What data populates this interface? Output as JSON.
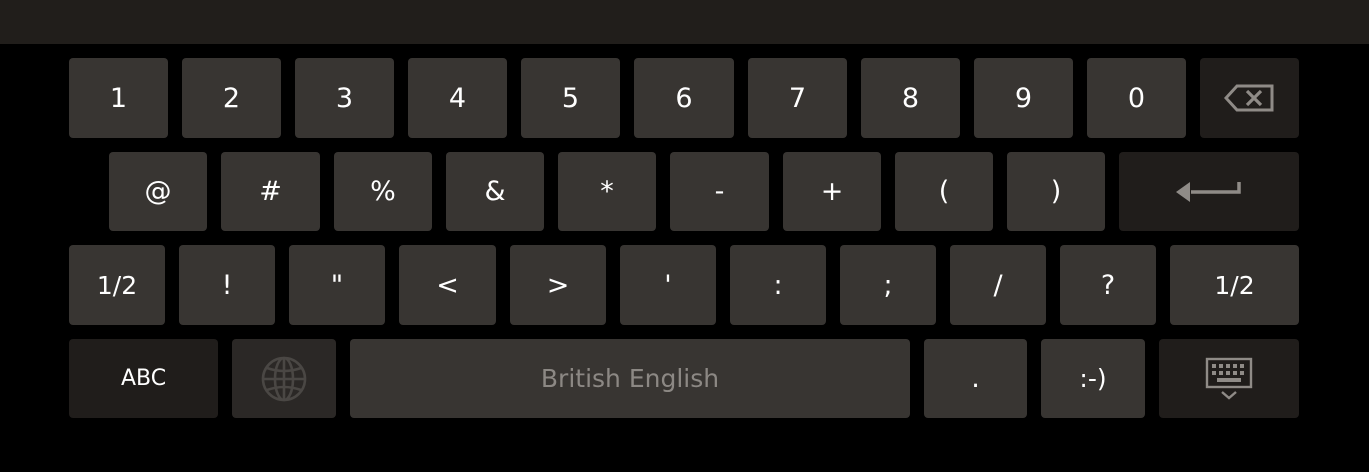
{
  "keyboard": {
    "row1": [
      "1",
      "2",
      "3",
      "4",
      "5",
      "6",
      "7",
      "8",
      "9",
      "0"
    ],
    "row2": [
      "@",
      "#",
      "%",
      "&",
      "*",
      "-",
      "+",
      "(",
      ")"
    ],
    "row3": [
      "1/2",
      "!",
      "\"",
      "<",
      ">",
      "'",
      ":",
      ";",
      "/",
      "?",
      "1/2"
    ],
    "row4": {
      "abc_label": "ABC",
      "space_label": "British English",
      "period_label": ".",
      "smiley_label": ":-)"
    },
    "icons": {
      "backspace": "backspace-icon",
      "enter": "enter-arrow-icon",
      "language": "globe-icon",
      "hide_keyboard": "keyboard-hide-icon"
    },
    "colors": {
      "background": "#000000",
      "topbar": "#211e1b",
      "key": "#383532",
      "key_dark": "#201d1b",
      "key_text": "#ffffff",
      "space_text": "#8c8884"
    }
  }
}
